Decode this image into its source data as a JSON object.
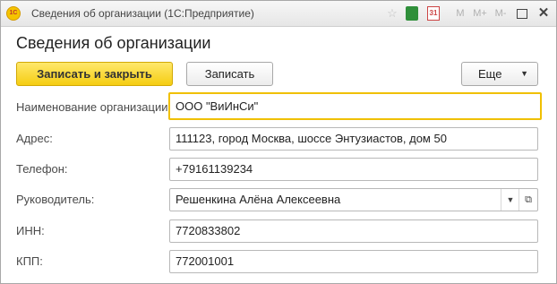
{
  "window": {
    "title": "Сведения об организации  (1С:Предприятие)",
    "logo_text": "1С",
    "toolbar_icons": [
      "star-icon",
      "calculator-icon",
      "calendar-icon",
      "m-icon",
      "m-plus-icon",
      "m-minus-icon",
      "maximize-icon",
      "close-icon"
    ],
    "calendar_text": "31",
    "m_label": "M",
    "m_plus_label": "M+",
    "m_minus_label": "M-"
  },
  "form": {
    "heading": "Сведения об организации",
    "buttons": {
      "save_and_close": "Записать и закрыть",
      "save": "Записать",
      "more": "Еще"
    },
    "fields": [
      {
        "label": "Наименование организации:",
        "value": "ООО \"ВиИнСи\""
      },
      {
        "label": "Адрес:",
        "value": "111123, город Москва, шоссе Энтузиастов, дом 50"
      },
      {
        "label": "Телефон:",
        "value": "+79161139234"
      },
      {
        "label": "Руководитель:",
        "value": "Решенкина Алёна Алексеевна"
      },
      {
        "label": "ИНН:",
        "value": "7720833802"
      },
      {
        "label": "КПП:",
        "value": "772001001"
      }
    ]
  },
  "colors": {
    "primary_button": "#f5cd12",
    "active_field_border": "#f0c000",
    "calculator_icon": "#2f8f3a",
    "calendar_icon": "#cc4444"
  }
}
